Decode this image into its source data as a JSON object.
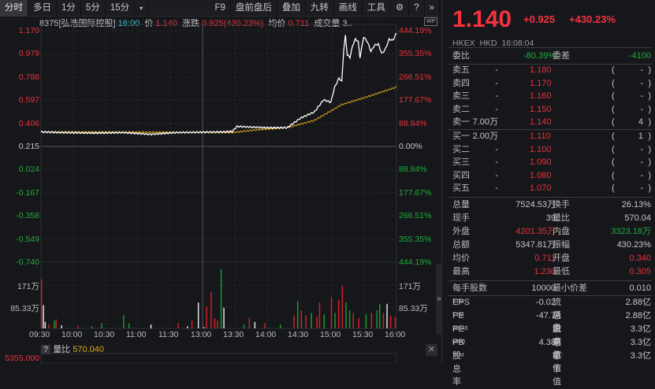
{
  "toolbar": {
    "tabs": [
      "分时",
      "多日",
      "1分",
      "5分",
      "15分"
    ],
    "more": "▾",
    "right": [
      "F9",
      "盘前盘后",
      "叠加",
      "九转",
      "画线",
      "工具"
    ],
    "icons": [
      "gear-icon",
      "help-icon",
      "collapse-icon"
    ]
  },
  "info": {
    "stock": "8375[弘浩国际控股]",
    "time": "16:00",
    "price_label": "价",
    "price": "1.140",
    "chg_label": "涨跌",
    "chg": "0.925(430.23%)",
    "avg_label": "均价",
    "avg": "0.711",
    "vol_label": "成交量",
    "vol": "3..",
    "wp": "WP"
  },
  "axis": {
    "left": [
      "1.170",
      "0.979",
      "0.788",
      "0.597",
      "0.406",
      "0.215",
      "0.024",
      "-0.167",
      "-0.358",
      "-0.549",
      "-0.740"
    ],
    "right": [
      "444.19%",
      "355.35%",
      "266.51%",
      "177.67%",
      "88.84%",
      "0.00%",
      "88.84%",
      "177.67%",
      "266.51%",
      "355.35%",
      "444.19%"
    ],
    "vol_left": [
      "171万",
      "85.33万"
    ],
    "vol_right": [
      "171万",
      "85.33万"
    ],
    "times": [
      "09:30",
      "10:00",
      "10:30",
      "11:00",
      "11:30",
      "13:00",
      "13:30",
      "14:00",
      "14:30",
      "15:00",
      "15:30",
      "16:00"
    ]
  },
  "chart_data": {
    "type": "line",
    "title": "8375 intraday",
    "ylim": [
      -0.74,
      1.17
    ],
    "prev_close": 0.215,
    "price": [
      [
        0,
        0.335
      ],
      [
        20,
        0.33
      ],
      [
        60,
        0.325
      ],
      [
        90,
        0.33
      ],
      [
        120,
        0.315
      ],
      [
        150,
        0.33
      ],
      [
        200,
        0.335
      ],
      [
        210,
        0.34
      ],
      [
        215,
        0.38
      ],
      [
        230,
        0.375
      ],
      [
        250,
        0.37
      ],
      [
        270,
        0.37
      ],
      [
        285,
        0.45
      ],
      [
        300,
        0.5
      ],
      [
        310,
        0.6
      ],
      [
        318,
        0.58
      ],
      [
        322,
        0.7
      ],
      [
        327,
        0.78
      ],
      [
        330,
        0.75
      ],
      [
        332,
        1.0
      ],
      [
        334,
        1.13
      ],
      [
        336,
        0.97
      ],
      [
        339,
        0.95
      ],
      [
        342,
        1.05
      ],
      [
        345,
        1.1
      ],
      [
        348,
        1.08
      ],
      [
        350,
        0.95
      ],
      [
        354,
        1.12
      ],
      [
        358,
        1.08
      ],
      [
        362,
        1.0
      ],
      [
        366,
        1.05
      ],
      [
        370,
        1.06
      ],
      [
        374,
        0.98
      ],
      [
        378,
        1.02
      ],
      [
        382,
        1.1
      ],
      [
        386,
        1.09
      ],
      [
        390,
        1.15
      ]
    ],
    "avg": [
      [
        0,
        0.335
      ],
      [
        210,
        0.33
      ],
      [
        240,
        0.355
      ],
      [
        270,
        0.37
      ],
      [
        300,
        0.43
      ],
      [
        330,
        0.56
      ],
      [
        360,
        0.63
      ],
      [
        390,
        0.705
      ]
    ],
    "volume_unit": "万",
    "vol_max": 256,
    "volume": [
      [
        0,
        190,
        "r"
      ],
      [
        2,
        90,
        "w"
      ],
      [
        4,
        25,
        "w"
      ],
      [
        8,
        15,
        "r"
      ],
      [
        14,
        30,
        "g"
      ],
      [
        16,
        35,
        "r"
      ],
      [
        22,
        12,
        "w"
      ],
      [
        40,
        10,
        "r"
      ],
      [
        55,
        8,
        "g"
      ],
      [
        66,
        20,
        "g"
      ],
      [
        90,
        50,
        "g"
      ],
      [
        96,
        20,
        "g"
      ],
      [
        120,
        15,
        "w"
      ],
      [
        150,
        20,
        "r"
      ],
      [
        160,
        8,
        "w"
      ],
      [
        165,
        30,
        "r"
      ],
      [
        172,
        100,
        "w"
      ],
      [
        178,
        5,
        "w"
      ],
      [
        181,
        85,
        "r"
      ],
      [
        186,
        140,
        "r"
      ],
      [
        190,
        40,
        "r"
      ],
      [
        193,
        30,
        "r"
      ],
      [
        197,
        230,
        "g"
      ],
      [
        200,
        80,
        "w"
      ],
      [
        222,
        15,
        "g"
      ],
      [
        228,
        40,
        "r"
      ],
      [
        234,
        25,
        "w"
      ],
      [
        245,
        20,
        "r"
      ],
      [
        262,
        15,
        "g"
      ],
      [
        277,
        50,
        "r"
      ],
      [
        281,
        105,
        "g"
      ],
      [
        285,
        70,
        "r"
      ],
      [
        290,
        50,
        "r"
      ],
      [
        296,
        60,
        "g"
      ],
      [
        302,
        45,
        "r"
      ],
      [
        305,
        100,
        "r"
      ],
      [
        310,
        55,
        "g"
      ],
      [
        318,
        120,
        "r"
      ],
      [
        322,
        60,
        "g"
      ],
      [
        326,
        110,
        "r"
      ],
      [
        330,
        165,
        "r"
      ],
      [
        334,
        100,
        "g"
      ],
      [
        338,
        70,
        "g"
      ],
      [
        342,
        60,
        "r"
      ],
      [
        348,
        40,
        "r"
      ],
      [
        356,
        55,
        "g"
      ],
      [
        362,
        60,
        "r"
      ],
      [
        368,
        70,
        "g"
      ],
      [
        371,
        95,
        "g"
      ],
      [
        375,
        60,
        "r"
      ],
      [
        379,
        95,
        "w"
      ],
      [
        383,
        50,
        "r"
      ],
      [
        388,
        45,
        "r"
      ]
    ]
  },
  "sub": {
    "help": "?",
    "label": "量比",
    "value": "570.040",
    "axis": "5355.000",
    "close": "✕"
  },
  "quote": {
    "price": "1.140",
    "chg": "+0.925",
    "pct": "+430.23%",
    "exchange": "HKEX",
    "currency": "HKD",
    "time": "16:08:04",
    "wb_label": "委比",
    "wb": "-80.39%",
    "wc_label": "委差",
    "wc": "-4100",
    "asks": [
      [
        "卖五",
        "1.180",
        "-",
        "-"
      ],
      [
        "卖四",
        "1.170",
        "-",
        "-"
      ],
      [
        "卖三",
        "1.160",
        "-",
        "-"
      ],
      [
        "卖二",
        "1.150",
        "-",
        "-"
      ],
      [
        "卖一",
        "1.140",
        "7.00万",
        "4"
      ]
    ],
    "bids": [
      [
        "买一",
        "1.110",
        "2.00万",
        "1"
      ],
      [
        "买二",
        "1.100",
        "-",
        "-"
      ],
      [
        "买三",
        "1.090",
        "-",
        "-"
      ],
      [
        "买四",
        "1.080",
        "-",
        "-"
      ],
      [
        "买五",
        "1.070",
        "-",
        "-"
      ]
    ],
    "stats": [
      [
        "总量",
        "7524.53万",
        "",
        "换手",
        "26.13%",
        ""
      ],
      [
        "现手",
        "39",
        "",
        "量比",
        "570.04",
        ""
      ],
      [
        "外盘",
        "4201.35万",
        "red",
        "内盘",
        "3323.18万",
        "green"
      ],
      [
        "总额",
        "5347.81万",
        "",
        "振幅",
        "430.23%",
        ""
      ],
      [
        "均价",
        "0.711",
        "red",
        "开盘",
        "0.340",
        "red"
      ],
      [
        "最高",
        "1.230",
        "red",
        "最低",
        "0.305",
        "red"
      ]
    ],
    "lot": [
      "每手股数",
      "10000",
      "最小价差",
      "0.010"
    ],
    "fund": [
      [
        "EPS",
        "TTM",
        "-0.02",
        "流通盘",
        "",
        "2.88亿"
      ],
      [
        "PE",
        "TTM",
        "-47.7",
        "总股本",
        "",
        "2.88亿"
      ],
      [
        "PE",
        "2024E",
        "-",
        "流通值",
        "",
        "3.3亿"
      ],
      [
        "PB",
        "MRQ",
        "4.38",
        "总市值",
        "1",
        "3.3亿"
      ],
      [
        "股息率",
        "TTM",
        "-",
        "总市值",
        "2 ⓘ",
        "3.3亿"
      ]
    ],
    "handle": "»"
  },
  "colors": {
    "up": "#e8323a",
    "down": "#1fae3c",
    "avg": "#e0a91a",
    "price_line": "#ffffff"
  }
}
